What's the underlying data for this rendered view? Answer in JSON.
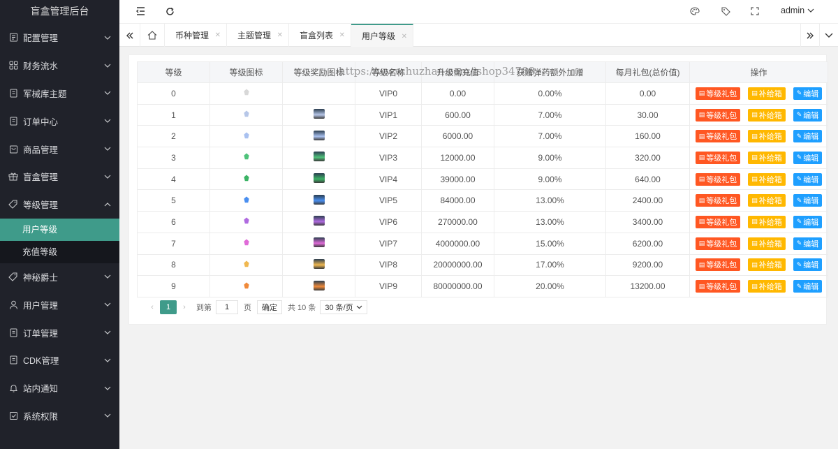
{
  "app": {
    "title": "盲盒管理后台"
  },
  "sidebar": {
    "items": [
      {
        "label": "配置管理",
        "icon": "settings-doc-icon"
      },
      {
        "label": "财务流水",
        "icon": "grid-icon"
      },
      {
        "label": "军械库主题",
        "icon": "doc-icon"
      },
      {
        "label": "订单中心",
        "icon": "doc-icon"
      },
      {
        "label": "商品管理",
        "icon": "bag-icon"
      },
      {
        "label": "盲盒管理",
        "icon": "gift-icon"
      },
      {
        "label": "等级管理",
        "icon": "tag-icon",
        "expanded": true
      },
      {
        "label": "神秘爵士",
        "icon": "tag-icon"
      },
      {
        "label": "用户管理",
        "icon": "user-icon"
      },
      {
        "label": "订单管理",
        "icon": "doc-icon"
      },
      {
        "label": "CDK管理",
        "icon": "doc-icon"
      },
      {
        "label": "站内通知",
        "icon": "bell-icon"
      },
      {
        "label": "系统权限",
        "icon": "shield-check-icon"
      }
    ],
    "submenu": [
      {
        "label": "用户等级",
        "active": true
      },
      {
        "label": "充值等级",
        "active": false
      }
    ]
  },
  "topbar": {
    "user": "admin"
  },
  "tabs": [
    {
      "label": "币种管理",
      "active": false
    },
    {
      "label": "主题管理",
      "active": false
    },
    {
      "label": "盲盒列表",
      "active": false
    },
    {
      "label": "用户等级",
      "active": true
    }
  ],
  "table": {
    "headers": [
      "等级",
      "等级图标",
      "等级奖励图标",
      "等级名称",
      "升级需充值",
      "获赠弹药额外加赠",
      "每月礼包(总价值)",
      "操作"
    ],
    "rows": [
      {
        "level": "0",
        "name": "VIP0",
        "recharge": "0.00",
        "bonus": "0.00%",
        "gift": "0.00",
        "icon_color": "#d8d8d8",
        "reward": false
      },
      {
        "level": "1",
        "name": "VIP1",
        "recharge": "600.00",
        "bonus": "7.00%",
        "gift": "30.00",
        "icon_color": "#b7c7e8",
        "reward": true
      },
      {
        "level": "2",
        "name": "VIP2",
        "recharge": "6000.00",
        "bonus": "7.00%",
        "gift": "160.00",
        "icon_color": "#a9c1f0",
        "reward": true
      },
      {
        "level": "3",
        "name": "VIP3",
        "recharge": "12000.00",
        "bonus": "9.00%",
        "gift": "320.00",
        "icon_color": "#4fc27a",
        "reward": true
      },
      {
        "level": "4",
        "name": "VIP4",
        "recharge": "39000.00",
        "bonus": "9.00%",
        "gift": "640.00",
        "icon_color": "#3bb365",
        "reward": true
      },
      {
        "level": "5",
        "name": "VIP5",
        "recharge": "84000.00",
        "bonus": "13.00%",
        "gift": "2400.00",
        "icon_color": "#4a8ff0",
        "reward": true
      },
      {
        "level": "6",
        "name": "VIP6",
        "recharge": "270000.00",
        "bonus": "13.00%",
        "gift": "3400.00",
        "icon_color": "#b06be0",
        "reward": true
      },
      {
        "level": "7",
        "name": "VIP7",
        "recharge": "4000000.00",
        "bonus": "15.00%",
        "gift": "6200.00",
        "icon_color": "#e06bd8",
        "reward": true
      },
      {
        "level": "8",
        "name": "VIP8",
        "recharge": "20000000.00",
        "bonus": "17.00%",
        "gift": "9200.00",
        "icon_color": "#f0b850",
        "reward": true
      },
      {
        "level": "9",
        "name": "VIP9",
        "recharge": "80000000.00",
        "bonus": "20.00%",
        "gift": "13200.00",
        "icon_color": "#f08a3a",
        "reward": true
      }
    ],
    "actions": {
      "gift": "等级礼包",
      "supply": "补给箱",
      "edit": "编辑"
    }
  },
  "watermark": "https://www.huzhan.com/ishop34788",
  "pager": {
    "current": "1",
    "goto_label": "到第",
    "goto_value": "1",
    "page_label": "页",
    "confirm": "确定",
    "total": "共 10 条",
    "page_size": "30 条/页"
  },
  "colors": {
    "accent": "#3f9b8a",
    "sidebar": "#20222a",
    "red": "#ff5722",
    "yellow": "#ffb800",
    "blue": "#1e9fff"
  }
}
